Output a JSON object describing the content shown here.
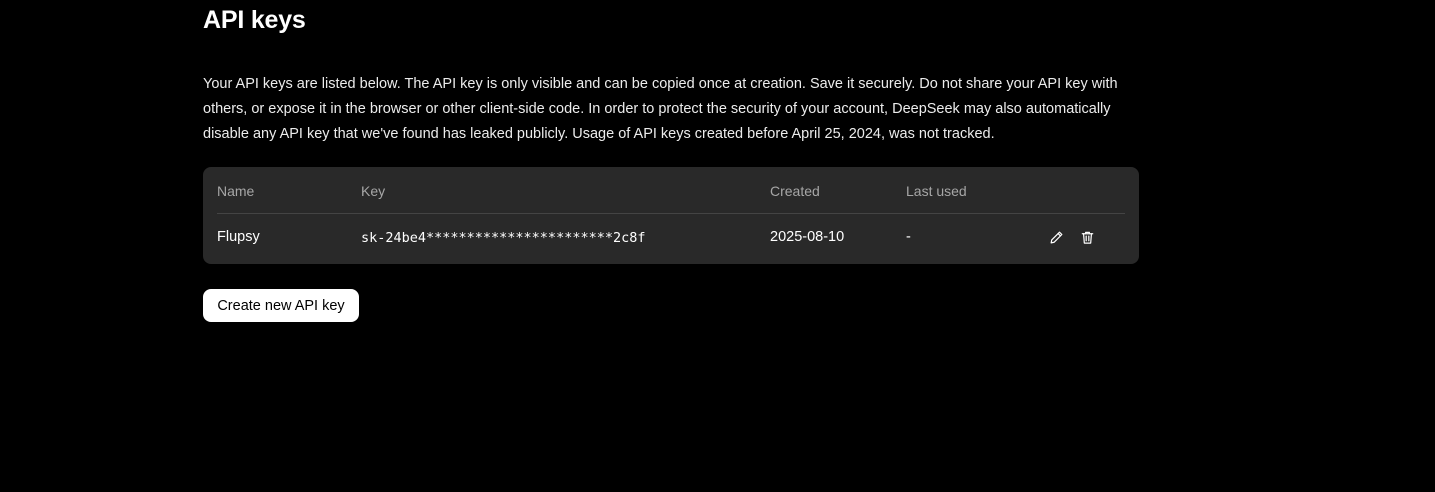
{
  "page": {
    "title": "API keys",
    "description": "Your API keys are listed below. The API key is only visible and can be copied once at creation. Save it securely. Do not share your API key with others, or expose it in the browser or other client-side code. In order to protect the security of your account, DeepSeek may also automatically disable any API key that we've found has leaked publicly. Usage of API keys created before April 25, 2024, was not tracked."
  },
  "table": {
    "columns": {
      "name": "Name",
      "key": "Key",
      "created": "Created",
      "last_used": "Last used"
    },
    "rows": [
      {
        "name": "Flupsy",
        "key": "sk-24be4***********************2c8f",
        "created": "2025-08-10",
        "last_used": "-",
        "actions": [
          "pencil-icon",
          "trash-icon"
        ]
      }
    ]
  },
  "buttons": {
    "create_label": "Create new API key"
  },
  "colors": {
    "background": "#000000",
    "card": "#292929",
    "header_text": "#a6a6a6",
    "button_bg": "#ffffff"
  }
}
